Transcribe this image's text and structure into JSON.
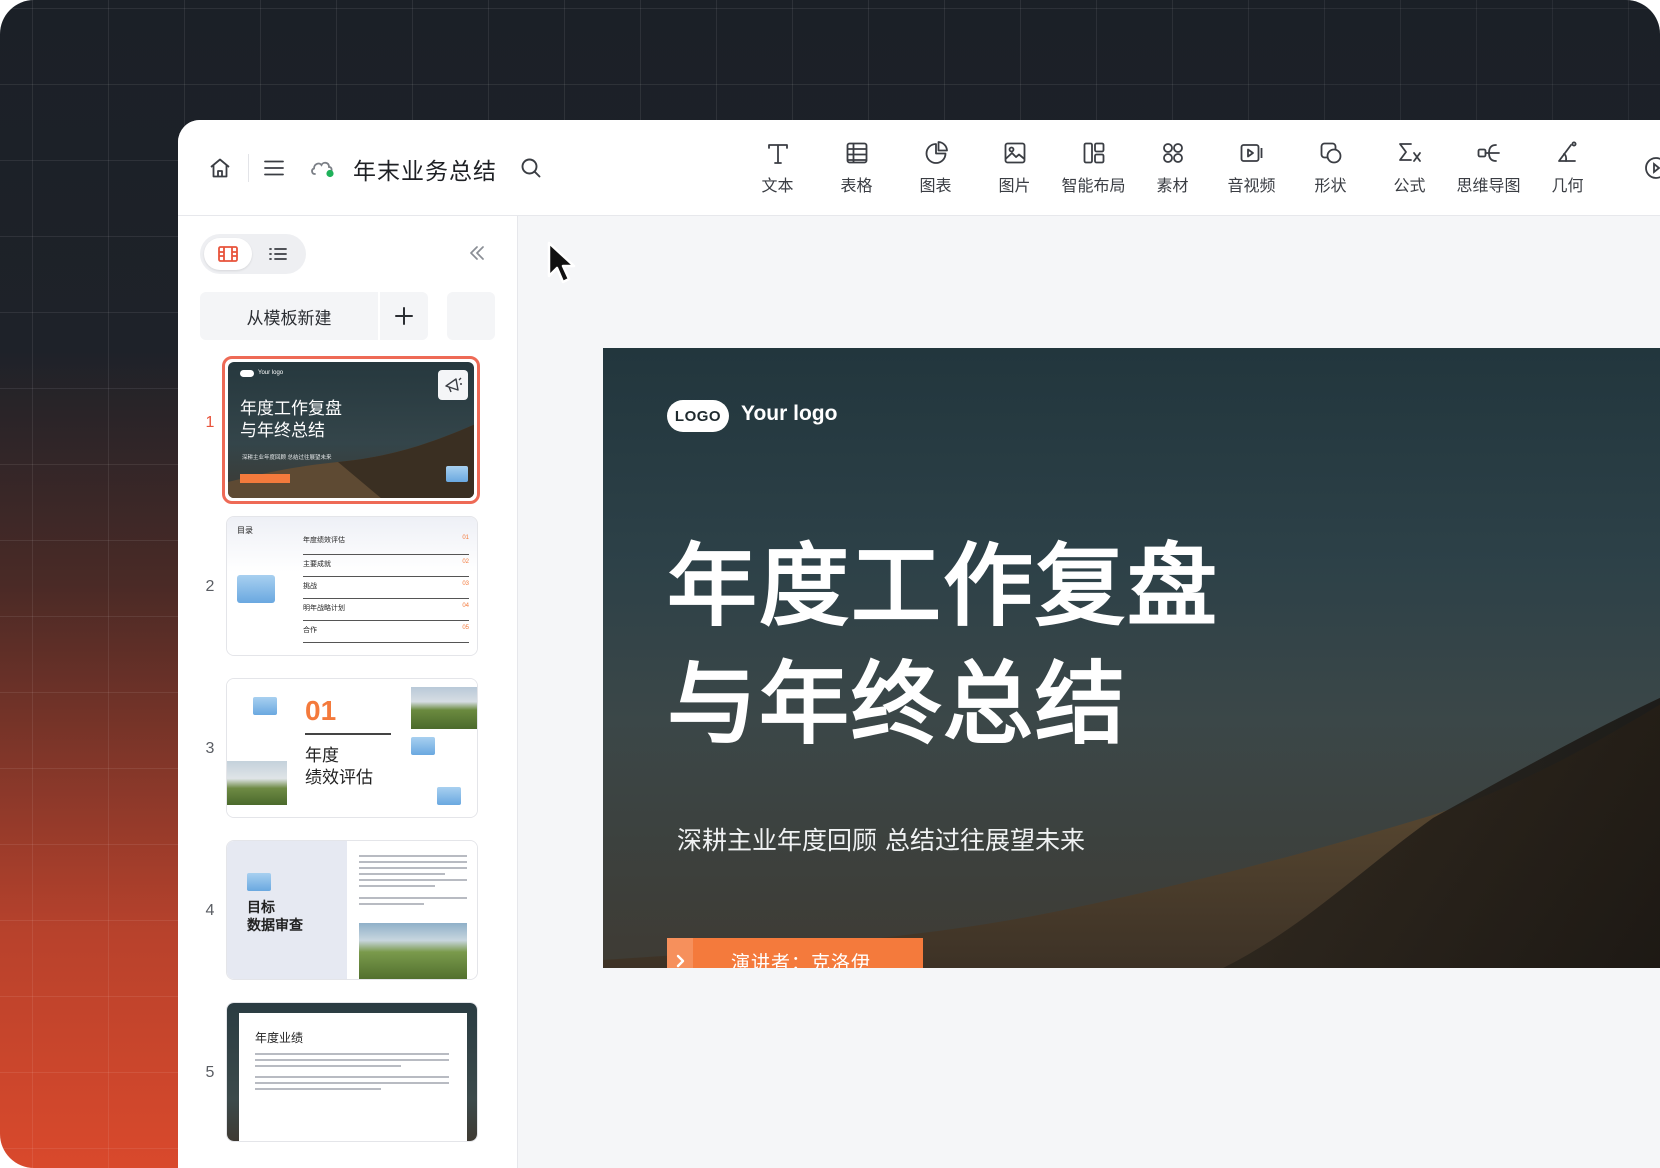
{
  "document": {
    "title": "年末业务总结"
  },
  "toolbar": {
    "tools": [
      {
        "label": "文本",
        "icon": "text-icon"
      },
      {
        "label": "表格",
        "icon": "table-icon"
      },
      {
        "label": "图表",
        "icon": "chart-icon"
      },
      {
        "label": "图片",
        "icon": "image-icon"
      },
      {
        "label": "智能布局",
        "icon": "smart-layout-icon"
      },
      {
        "label": "素材",
        "icon": "assets-icon"
      },
      {
        "label": "音视频",
        "icon": "video-icon"
      },
      {
        "label": "形状",
        "icon": "shape-icon"
      },
      {
        "label": "公式",
        "icon": "formula-icon"
      },
      {
        "label": "思维导图",
        "icon": "mindmap-icon"
      },
      {
        "label": "几何",
        "icon": "geometry-icon"
      }
    ]
  },
  "sidebar": {
    "new_from_template": "从模板新建",
    "slides": [
      {
        "number": "1",
        "title_line1": "年度工作复盘",
        "title_line2": "与年终总结",
        "subtitle": "深耕主业年度回顾 总结过往展望未来",
        "logo": "Your logo",
        "selected": true
      },
      {
        "number": "2",
        "heading": "目录",
        "items": [
          {
            "text": "年度绩效评估",
            "num": "01"
          },
          {
            "text": "主要成就",
            "num": "02"
          },
          {
            "text": "挑战",
            "num": "03"
          },
          {
            "text": "明年战略计划",
            "num": "04"
          },
          {
            "text": "合作",
            "num": "05"
          }
        ]
      },
      {
        "number": "3",
        "big_num": "01",
        "line1": "年度",
        "line2": "绩效评估"
      },
      {
        "number": "4",
        "line1": "目标",
        "line2": "数据审查"
      },
      {
        "number": "5",
        "heading": "年度业绩"
      }
    ]
  },
  "slide": {
    "logo_badge": "LOGO",
    "logo_text": "Your logo",
    "title_line1": "年度工作复盘",
    "title_line2": "与年终总结",
    "subtitle": "深耕主业年度回顾 总结过往展望未来",
    "speaker": "演讲者：克洛伊"
  },
  "colors": {
    "accent": "#f47a3c",
    "selection": "#ee6a56",
    "slide_bg": "#2d4148"
  }
}
